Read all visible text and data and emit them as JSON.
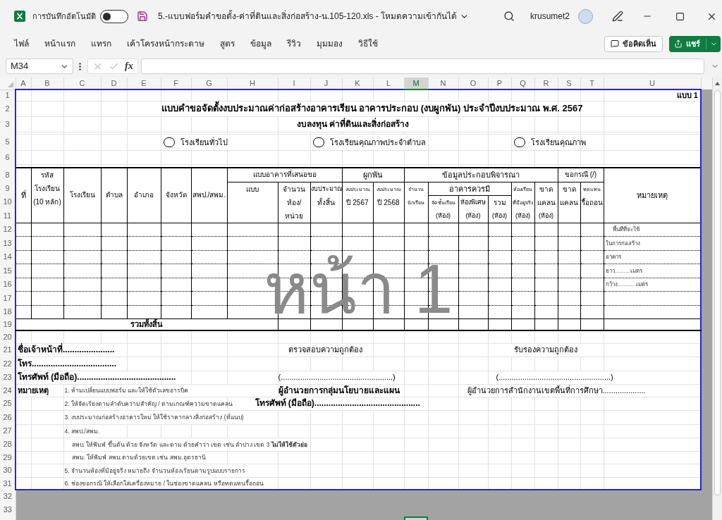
{
  "title_bar": {
    "autosave": {
      "label": "การบันทึกอัตโนมัติ",
      "on": false
    },
    "document_title": "5.-แบบฟอร์มคำขอตั้ง-ค่าที่ดินและสิ่งก่อสร้าง-น.105-120.xls  -  โหมดความเข้ากันได้",
    "user_name": "krusumet2"
  },
  "ribbon": {
    "tabs": [
      {
        "label": "ไฟล์"
      },
      {
        "label": "หน้าแรก"
      },
      {
        "label": "แทรก"
      },
      {
        "label": "เค้าโครงหน้ากระดาษ"
      },
      {
        "label": "สูตร"
      },
      {
        "label": "ข้อมูล"
      },
      {
        "label": "รีวิว"
      },
      {
        "label": "มุมมอง"
      },
      {
        "label": "วิธีใช้"
      }
    ],
    "comments_button": "ข้อคิดเห็น",
    "share_button": "แชร์"
  },
  "formula_bar": {
    "name_box": "M34",
    "cancel_button": {
      "disabled": true
    },
    "enter_button": {
      "disabled": true
    },
    "function_button": "fx"
  },
  "sheet": {
    "columns": [
      {
        "label": "A",
        "selected": false
      },
      {
        "label": "B",
        "selected": false
      },
      {
        "label": "C",
        "selected": false
      },
      {
        "label": "D",
        "selected": false
      },
      {
        "label": "E",
        "selected": false
      },
      {
        "label": "F",
        "selected": false
      },
      {
        "label": "G",
        "selected": false
      },
      {
        "label": "H",
        "selected": false
      },
      {
        "label": "I",
        "selected": false
      },
      {
        "label": "J",
        "selected": false
      },
      {
        "label": "K",
        "selected": false
      },
      {
        "label": "L",
        "selected": false
      },
      {
        "label": "M",
        "selected": true
      },
      {
        "label": "N",
        "selected": false
      },
      {
        "label": "O",
        "selected": false
      },
      {
        "label": "P",
        "selected": false
      },
      {
        "label": "Q",
        "selected": false
      },
      {
        "label": "R",
        "selected": false
      },
      {
        "label": "S",
        "selected": false
      },
      {
        "label": "T",
        "selected": false
      },
      {
        "label": "U",
        "selected": false
      }
    ],
    "row_numbers": [
      "1",
      "2",
      "3",
      "5",
      "6",
      "8",
      "9",
      "10",
      "11",
      "12",
      "13",
      "14",
      "15",
      "16",
      "17",
      "18",
      "19",
      "20",
      "21",
      "22",
      "23",
      "24",
      "25",
      "26",
      "27",
      "28",
      "29",
      "30",
      "31",
      "32",
      "33"
    ],
    "page_label": "หน้า 1",
    "form": {
      "form_number": "แบบ 1",
      "title": "แบบคำขอจัดตั้งงบประมาณค่าก่อสร้างอาคารเรียน อาคารประกอบ (งบผูกพัน) ประจำปีงบประมาณ พ.ศ. 2567",
      "subtitle": "งบลงทุน  ค่าที่ดินและสิ่งก่อสร้าง",
      "school_types": [
        {
          "label": "โรงเรียนทั่วไป",
          "selected": false
        },
        {
          "label": "โรงเรียนคุณภาพประจำตำบล",
          "selected": false
        },
        {
          "label": "โรงเรียนคุณภาพ",
          "selected": false
        }
      ],
      "table_header": {
        "number": "ที่",
        "school_code": [
          "รหัส",
          "โรงเรียน",
          "(10 หลัก)"
        ],
        "school": "โรงเรียน",
        "subdistrict": "ตำบล",
        "district": "อำเภอ",
        "province": "จังหวัด",
        "education_office": "สพป./สพม.",
        "proposed_building": {
          "label": "แบบอาคารที่เสนอขอ",
          "design": "แบบ",
          "units": [
            "จำนวน",
            "ห้อง/",
            "หน่วย"
          ],
          "budget": [
            "งบประมาณ",
            "ทั้งสิ้น"
          ]
        },
        "commitment": {
          "label": "ผูกพัน",
          "first_year": [
            "งบประมาณ",
            "ปี 2567"
          ],
          "second_year": [
            "งบประมาณ",
            "ปี 2568"
          ]
        },
        "supporting_data": {
          "label": "ข้อมูลประกอบพิจารณา",
          "students": [
            "จำนวน",
            "นักเรียน"
          ],
          "required_buildings": {
            "label": "อาคารควรมี",
            "classrooms": [
              "จัดชั้นเรียน",
              "(ห้อง)"
            ],
            "special_rooms": [
              "ห้องพิเศษ",
              "(ห้อง)"
            ],
            "total": [
              "รวม",
              "(ห้อง)"
            ]
          },
          "existing_rooms": [
            "ห้องเรียน",
            "ที่มีอยู่จริง",
            "(ห้อง)"
          ],
          "shortage": [
            "ขาด",
            "แคลน",
            "(ห้อง)"
          ]
        },
        "request_case": {
          "label": "ขอกรณี (/)",
          "shortage": [
            "ขาด",
            "แคลน"
          ],
          "replacement": [
            "ทดแทน",
            "รื้อถอน"
          ]
        },
        "remarks": "หมายเหตุ"
      },
      "remarks_notes": [
        "พื้นที่ที่จะใช้",
        "ในการก่อสร้าง",
        "อาคาร",
        "ยาว..........เมตร",
        "กว้าง............เมตร"
      ],
      "total_label": "รวมทั้งสิ้น",
      "officer": {
        "name": "ชื่อเจ้าหน้าที่......................",
        "phone": "โทร....................................",
        "mobile": "โทรศัพท์ (มือถือ).........................................."
      },
      "verification": {
        "heading": "ตรวจสอบความถูกต้อง",
        "signature": "(....................................................)",
        "position": "ผู้อำนวยการกลุ่มนโยบายและแผน",
        "phone": "โทรศัพท์ (มือถือ)............................................."
      },
      "certification": {
        "heading": "รับรองความถูกต้อง",
        "signature": "(....................................................)",
        "position": "ผู้อำนวยการสำนักงานเขตพื้นที่การศึกษา...................."
      },
      "notes_heading": "หมายเหตุ",
      "notes": [
        {
          "text": "1. ห้ามเปลี่ยนแบบฟอร์ม  และให้ใช้ตัวเลขอารบิค"
        },
        {
          "text": "2. ให้จัดเรียงตามลำดับความสำคัญ / ตามเกณฑ์ความขาดแคลน"
        },
        {
          "text": "3. งบประมาณก่อสร้างอาคารใหม่ ให้ใช้ราคากลางสิ่งก่อสร้าง (ที่แนบ)"
        },
        {
          "text": "4. สพป./สพม.",
          "children": [
            {
              "text": "สพป. ให้พิมพ์ ขึ้นต้น ด้วย จังหวัด และตาม ด้วยคำว่า เขต  เช่น ลำปาง  เขต 3  **ไม่ให้ใช้ตัวย่อ**"
            },
            {
              "text": "สพม.  ให้พิมพ์ สพม.ตามด้วยเขต  เช่น สพม.อุดรธานี"
            }
          ]
        },
        {
          "text": "5. จำนวนห้องที่มีอยู่จริง หมายถึง จำนวนห้องเรียนตามรูปแบบรายการ"
        },
        {
          "text": "6. ช่องขอกรณี  ให้เลือกใส่เครื่องหมาย /  ในช่องขาดแคลน หรือทดแทนรื้อถอน"
        }
      ]
    }
  }
}
